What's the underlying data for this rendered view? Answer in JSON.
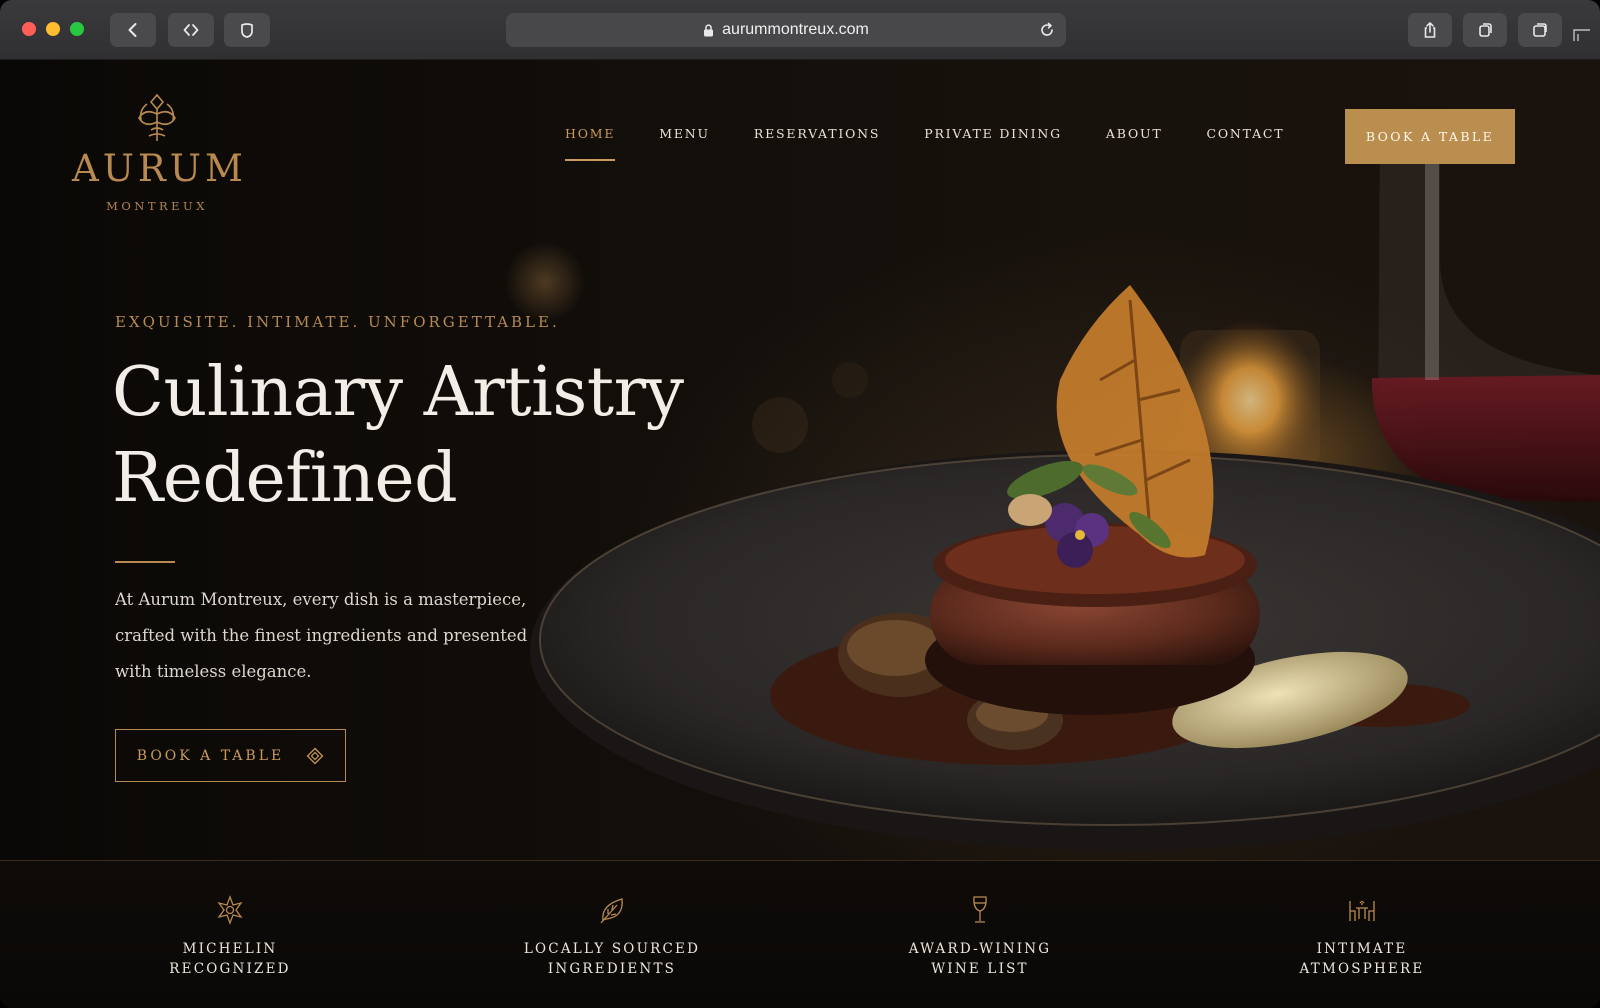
{
  "browser": {
    "url": "aurummontreux.com"
  },
  "brand": {
    "name": "AURUM",
    "location": "MONTREUX",
    "accent_color": "#b98a4f"
  },
  "nav": {
    "items": [
      {
        "label": "HOME",
        "active": true
      },
      {
        "label": "MENU",
        "active": false
      },
      {
        "label": "RESERVATIONS",
        "active": false
      },
      {
        "label": "PRIVATE DINING",
        "active": false
      },
      {
        "label": "ABOUT",
        "active": false
      },
      {
        "label": "CONTACT",
        "active": false
      }
    ],
    "cta_label": "BOOK A TABLE"
  },
  "hero": {
    "eyebrow": "EXQUISITE. INTIMATE. UNFORGETTABLE.",
    "headline_line1": "Culinary Artistry",
    "headline_line2": "Redefined",
    "body": "At Aurum Montreux, every dish is a masterpiece, crafted with the finest ingredients and presented with timeless elegance.",
    "cta_label": "BOOK A TABLE",
    "cta_icon": "diamond-icon"
  },
  "features": [
    {
      "label": "MICHELIN\nRECOGNIZED",
      "icon": "michelin-star-icon"
    },
    {
      "label": "LOCALLY SOURCED\nINGREDIENTS",
      "icon": "leaf-icon"
    },
    {
      "label": "AWARD-WINING\nWINE LIST",
      "icon": "wine-glass-icon"
    },
    {
      "label": "INTIMATE\nATMOSPHERE",
      "icon": "dining-table-icon"
    }
  ]
}
